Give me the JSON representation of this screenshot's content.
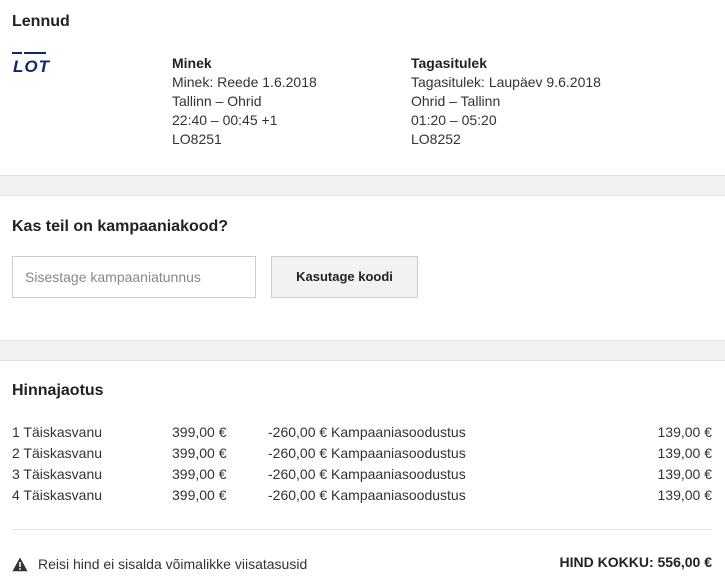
{
  "flights": {
    "heading": "Lennud",
    "airline_logo": "LOT",
    "outbound": {
      "title": "Minek",
      "date": "Minek: Reede 1.6.2018",
      "route": "Tallinn – Ohrid",
      "time": "22:40 – 00:45 +1",
      "flight_no": "LO8251"
    },
    "return": {
      "title": "Tagasitulek",
      "date": "Tagasitulek: Laupäev 9.6.2018",
      "route": "Ohrid – Tallinn",
      "time": "01:20 – 05:20",
      "flight_no": "LO8252"
    }
  },
  "promo": {
    "heading": "Kas teil on kampaaniakood?",
    "placeholder": "Sisestage kampaaniatunnus",
    "button_label": "Kasutage koodi"
  },
  "pricing": {
    "heading": "Hinnajaotus",
    "rows": [
      {
        "passenger": "1 Täiskasvanu",
        "price": "399,00 €",
        "discount": "-260,00 € Kampaaniasoodustus",
        "total": "139,00 €"
      },
      {
        "passenger": "2 Täiskasvanu",
        "price": "399,00 €",
        "discount": "-260,00 € Kampaaniasoodustus",
        "total": "139,00 €"
      },
      {
        "passenger": "3 Täiskasvanu",
        "price": "399,00 €",
        "discount": "-260,00 € Kampaaniasoodustus",
        "total": "139,00 €"
      },
      {
        "passenger": "4 Täiskasvanu",
        "price": "399,00 €",
        "discount": "-260,00 € Kampaaniasoodustus",
        "total": "139,00 €"
      }
    ],
    "notice": "Reisi hind ei sisalda võimalikke viisatasusid",
    "grand_total": "HIND KOKKU: 556,00 €"
  },
  "icons": {
    "logo": "lot-airline-logo",
    "notice": "warning-triangle-icon"
  },
  "colors": {
    "text": "#333333",
    "heading": "#222222",
    "band": "#f1f1f1",
    "logo_blue": "#0f2a6b"
  }
}
